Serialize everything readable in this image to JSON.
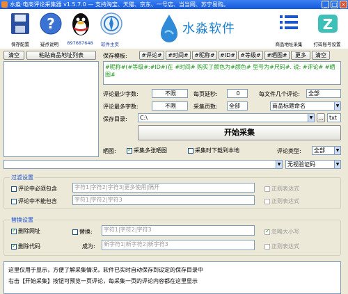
{
  "window": {
    "title": "水淼·电商评论采集器 v1.5.7.0 — 支持淘宝、天猫、京东、一号店、当当网、苏宁易购。"
  },
  "toolbar": {
    "save": "保存配置",
    "help": "疑点说明",
    "qq": "897687648",
    "home": "软件主页",
    "brand": "水淼软件",
    "url_collect": "商品地址采集",
    "account": "打码账号设置"
  },
  "left": {
    "clear": "清空",
    "paste": "粘贴商品地址列表"
  },
  "template": {
    "label": "保存模板:",
    "tags": [
      "#评论#",
      "#时间#",
      "#昵称#",
      "#ID#",
      "#等级#",
      "#晒图#"
    ],
    "more": "更多",
    "clear": "清空",
    "content": "#昵称#(#等级#:#ID#)在 #时间# 购买了颜色为#颜色# 型号为#尺码#. 说: #评论# #晒图#"
  },
  "settings": {
    "min_words_label": "评论最少字数:",
    "min_words": "不限",
    "delay_label": "每页延秒:",
    "delay": "0",
    "per_file_label": "每文件几个评论:",
    "per_file": "全部",
    "max_words_label": "评论最多字数:",
    "max_words": "不限",
    "pages_label": "采集页数:",
    "pages": "全部",
    "naming": "商品标题命名",
    "dir_label": "保存目录:",
    "dir": "C:\\",
    "ellipsis": "…",
    "ext": "txt",
    "start": "开始采集",
    "image_label": "晒图:",
    "multi_image": "采集多张晒图",
    "download_local": "采集时下载到本地",
    "type_label": "评论类型:",
    "type": "全部",
    "captcha": "无视验证码"
  },
  "filter": {
    "title": "过滤设置",
    "must_label": "评论中必须包含",
    "must_value": "字符1|字符2|字符3|更多使用|隔开",
    "not_label": "评论中不能包含",
    "not_value": "字符1|字符2|字符3",
    "regex": "正则表达式"
  },
  "replace": {
    "title": "替换设置",
    "del_url": "删除网址",
    "del_code": "删除代码",
    "replace_label": "替换:",
    "replace_value": "字符1|字符2|字符3",
    "to_label": "成为:",
    "to_value": "新字符1|新字符2|新字符3",
    "ignore_case": "忽略大小写",
    "regex": "正则表达式"
  },
  "log": {
    "line1": "这里仅用于显示，方便了解采集情况，软件已实时自动保存到设定的保存目录中",
    "line2": "右击【开始采集】按钮可预览一页评论，每采集一页的评论内容都在这里显示"
  },
  "colors": {
    "accent": "#1b4fd0",
    "titlebar": "#1458d9"
  }
}
